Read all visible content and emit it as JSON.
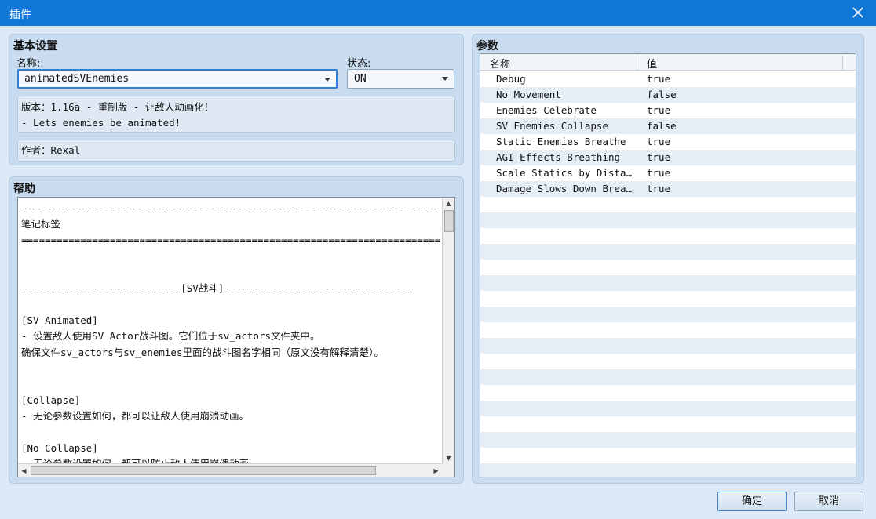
{
  "window": {
    "title": "插件"
  },
  "basic": {
    "title": "基本设置",
    "name_label": "名称:",
    "name_value": "animatedSVEnemies",
    "status_label": "状态:",
    "status_value": "ON",
    "version_line1": "版本：1.16a - 重制版 - 让敌人动画化！",
    "version_line2": "- Lets enemies be animated!",
    "author": "作者：Rexal"
  },
  "help": {
    "title": "帮助",
    "lines": [
      "--------------------------------------------------------------------------------",
      "笔记标签",
      "================================================================================",
      "",
      "",
      "---------------------------[SV战斗]--------------------------------",
      "",
      "[SV Animated]",
      "- 设置敌人使用SV Actor战斗图。它们位于sv_actors文件夹中。",
      "确保文件sv_actors与sv_enemies里面的战斗图名字相同（原文没有解释清楚）。",
      "",
      "",
      "[Collapse]",
      "- 无论参数设置如何，都可以让敌人使用崩溃动画。",
      "",
      "[No Collapse]",
      "- 无论参数设置如何，都可以防止敌人使用崩溃动画"
    ]
  },
  "params": {
    "title": "参数",
    "col_name": "名称",
    "col_value": "值",
    "rows": [
      {
        "name": "Debug",
        "value": "true"
      },
      {
        "name": "No Movement",
        "value": "false"
      },
      {
        "name": "Enemies Celebrate",
        "value": "true"
      },
      {
        "name": "SV Enemies Collapse",
        "value": "false"
      },
      {
        "name": "Static Enemies Breathe",
        "value": "true"
      },
      {
        "name": "AGI Effects Breathing",
        "value": "true"
      },
      {
        "name": "Scale Statics by Distance",
        "value": "true"
      },
      {
        "name": "Damage Slows Down Breath…",
        "value": "true"
      }
    ]
  },
  "buttons": {
    "ok": "确定",
    "cancel": "取消"
  }
}
